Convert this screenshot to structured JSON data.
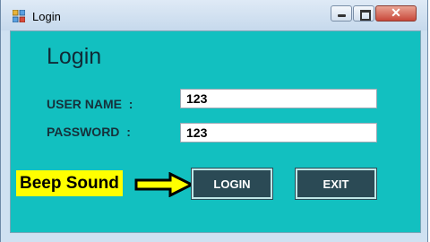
{
  "window": {
    "title": "Login",
    "controls": {
      "minimize": "minimize",
      "maximize": "maximize",
      "close": "✕"
    }
  },
  "form": {
    "heading": "Login",
    "username_label": "USER NAME  :",
    "password_label": "PASSWORD  :",
    "username_value": "123",
    "password_value": "123",
    "login_button": "LOGIN",
    "exit_button": "EXIT"
  },
  "annotation": {
    "text": "Beep Sound",
    "arrow_icon": "right-arrow-icon"
  },
  "colors": {
    "client_background": "#12c0c0",
    "button_background": "#2b4a55",
    "annotation_highlight": "#ffff00",
    "close_button": "#c8483a"
  },
  "icons": {
    "app": "form-app-icon",
    "minimize": "minimize-icon",
    "maximize": "maximize-icon",
    "close": "close-icon"
  }
}
